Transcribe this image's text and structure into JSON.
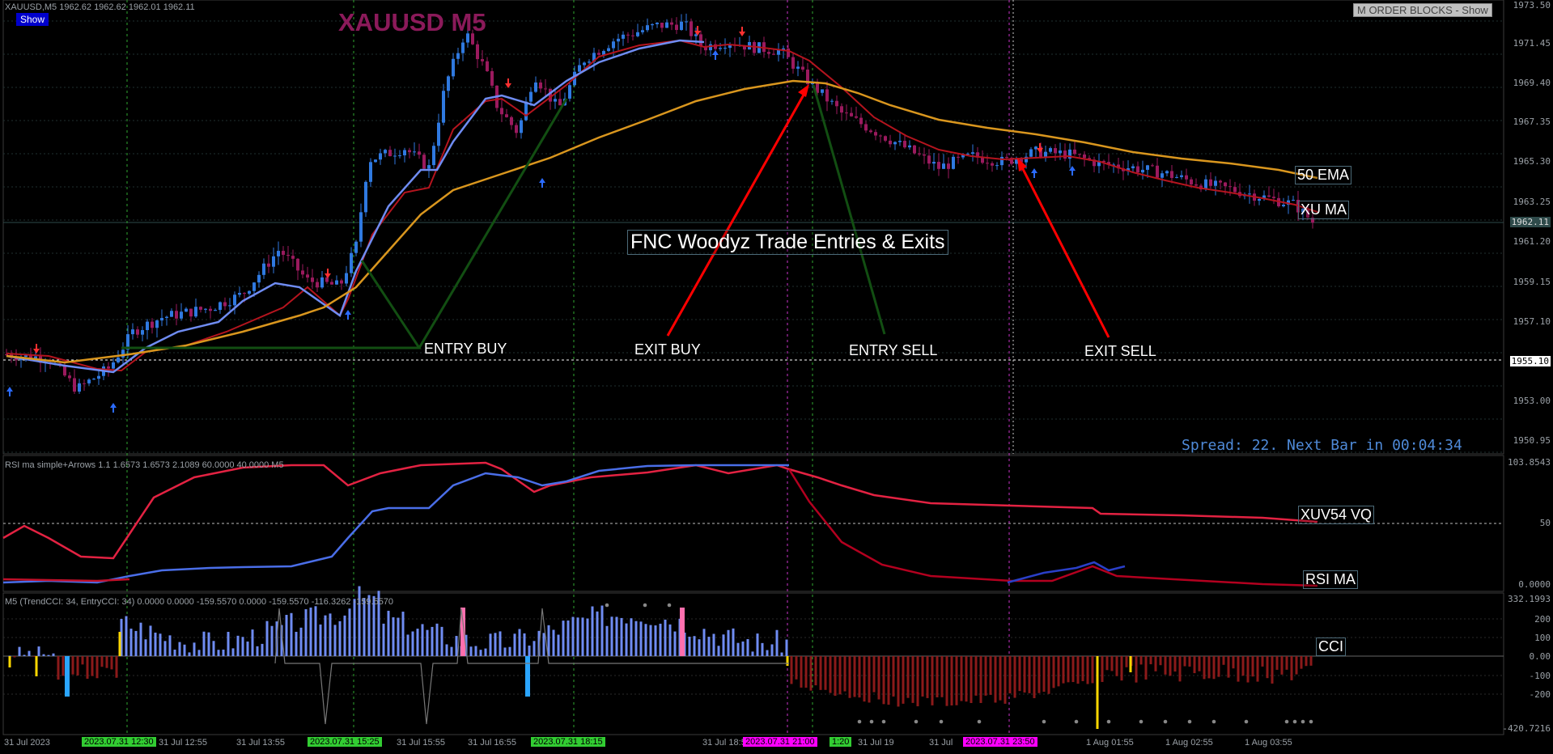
{
  "window": {
    "title": "XAUUSD,M5",
    "ohlc": "1962.62 1962.62 1962.01 1962.11"
  },
  "show_button": "Show",
  "order_blocks_button": "M ORDER BLOCKS - Show",
  "main_title": "XAUUSD M5",
  "chart_caption": "FNC Woodyz Trade Entries & Exits",
  "labels": {
    "entry_buy": "ENTRY BUY",
    "exit_buy": "EXIT BUY",
    "entry_sell": "ENTRY SELL",
    "exit_sell": "EXIT SELL",
    "ema50": "50 EMA",
    "xu_ma": "XU MA",
    "xuv54": "XUV54 VQ",
    "rsi_ma": "RSI MA",
    "cci": "CCI"
  },
  "spread_text": "Spread: 22. Next Bar in 00:04:34",
  "price_axis": [
    "1973.50",
    "1971.45",
    "1969.40",
    "1967.35",
    "1965.30",
    "1963.25",
    "1962.11",
    "1961.20",
    "1959.15",
    "1957.10",
    "1955.10",
    "1953.00",
    "1950.95"
  ],
  "rsi_panel": {
    "header": "RSI ma simple+Arrows 1.1 1.6573 1.6573 2.1089 60.0000 40.0000  M5",
    "axis": [
      "103.8543",
      "50",
      "0.0000"
    ]
  },
  "cci_panel": {
    "header": "M5 (TrendCCI: 34, EntryCCI: 34)  0.0000 0.0000 -159.5570 0.0000 -159.5570 -116.3262 -159.5570",
    "axis": [
      "332.1993",
      "200",
      "100",
      "0.00",
      "-100",
      "-200",
      "-420.7216"
    ]
  },
  "time_axis": [
    "31 Jul 2023",
    "31 Jul 12:55",
    "31 Jul 13:55",
    "31 Jul 15:55",
    "31 Jul 16:55",
    "31 Jul 18:55",
    "31 Jul 19",
    "31 Jul 21:55",
    "31 Jul",
    "1 Aug 01:55",
    "1 Aug 02:55",
    "1 Aug 03:55"
  ],
  "time_tags": [
    {
      "text": "2023.07.31 12:30",
      "color": "#32cd32"
    },
    {
      "text": "2023.07.31 15:25",
      "color": "#32cd32"
    },
    {
      "text": "2023.07.31 18:15",
      "color": "#32cd32"
    },
    {
      "text": "2023.07.31 21:00",
      "color": "#ff00ff"
    },
    {
      "text": "1:20",
      "color": "#32cd32"
    },
    {
      "text": "2023.07.31 23:50",
      "color": "#ff00ff"
    }
  ],
  "colors": {
    "bull": "#2f79e0",
    "bear": "#9b1a5e",
    "ema50": "#d9961e",
    "xu_ma": "#b4141e",
    "fast_ma": "#6f8cf2",
    "title": "#8b1a5a",
    "entry_line": "#124e12",
    "exit_line": "#ff0000",
    "spread": "#4f8ad8"
  }
}
